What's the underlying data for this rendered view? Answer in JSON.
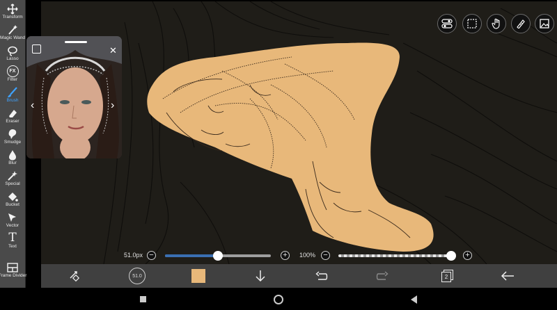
{
  "toolbar": {
    "tools": [
      {
        "label": "Transform",
        "icon": "transform-icon"
      },
      {
        "label": "Magic Wand",
        "icon": "magic-wand-icon"
      },
      {
        "label": "Lasso",
        "icon": "lasso-icon"
      },
      {
        "label": "Filter",
        "icon": "fx-icon"
      },
      {
        "label": "Brush",
        "icon": "brush-icon",
        "active": true
      },
      {
        "label": "Eraser",
        "icon": "eraser-icon"
      },
      {
        "label": "Smudge",
        "icon": "smudge-icon"
      },
      {
        "label": "Blur",
        "icon": "blur-icon"
      },
      {
        "label": "Special",
        "icon": "special-icon"
      },
      {
        "label": "Bucket",
        "icon": "bucket-icon"
      },
      {
        "label": "Vector",
        "icon": "vector-icon"
      },
      {
        "label": "Text",
        "icon": "text-icon"
      },
      {
        "label": "Frame Divider",
        "icon": "frame-divider-icon"
      }
    ],
    "filter_glyph": "FX",
    "text_glyph": "T"
  },
  "brush_size": {
    "label": "51.0px",
    "value_fraction": 0.5
  },
  "opacity": {
    "label": "100%",
    "value_fraction": 1.0
  },
  "bottom": {
    "brush_size_badge": "51.0",
    "layers_count": "2",
    "primary_color": "#e8b87a"
  },
  "colors": {
    "accent": "#3fa3ff",
    "canvas_bg": "#1f1d18",
    "fill": "#e8b87a"
  }
}
